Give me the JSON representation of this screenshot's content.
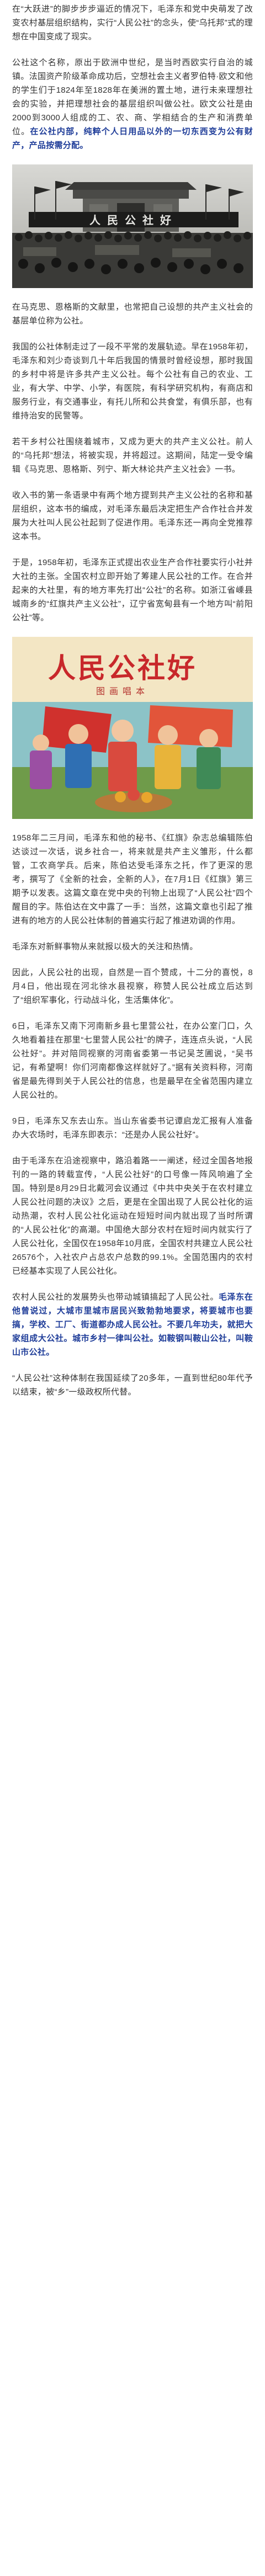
{
  "article": {
    "p1": "在“大跃进”的脚步步步逼近的情况下，毛泽东和党中央萌发了改变农村基层组织结构，实行“人民公社”的念头，使“乌托邦”式的理想在中国变成了现实。",
    "p2_pre": "公社这个名称，原出于欧洲中世纪，是当时西欧实行自治的城镇。法国资产阶级革命成功后，空想社会主义者罗伯特·欧文和他的学生们于1824年至1828年在美洲的置土地，进行未来理想社会的实验，并把理想社会的基层组织叫做公社。欧文公社是由2000到3000人组成的工、农、商、学相结合的生产和消费单位。",
    "p2_hl": "在公社内部，纯粹个人日用品以外的一切东西变为公有财产，产品按需分配。",
    "p3": "在马克思、恩格斯的文献里，也常把自己设想的共产主义社会的基层单位称为公社。",
    "p4": "我国的公社体制走过了一段不平常的发展轨迹。早在1958年初，毛泽东和刘少奇谈到几十年后我国的情景时曾经设想，那时我国的乡村中将是许多共产主义公社。每个公社有自己的农业、工业，有大学、中学、小学，有医院，有科学研究机构，有商店和服务行业，有交通事业，有托儿所和公共食堂，有俱乐部，也有维持治安的民警等。",
    "p5": "若干乡村公社围绕着城市，又成为更大的共产主义公社。前人的“乌托邦”想法，将被实现，并将超过。这期间，陆定一受令编辑《马克思、恩格斯、列宁、斯大林论共产主义社会》一书。",
    "p6": "收入书的第一条语录中有两个地方提到共产主义公社的名称和基层组织，这本书的编成，对毛泽东最后决定把生产合作社合并发展为大社叫人民公社起到了促进作用。毛泽东还一再向全党推荐这本书。",
    "p7": "于是，1958年初，毛泽东正式提出农业生产合作社要实行小社并大社的主张。全国农村立即开始了筹建人民公社的工作。在合并起来的大社里，有的地方率先打出“公社”的名称。如浙江省嵊县城南乡的“红旗共产主义公社”，辽宁省宽甸县有一个地方叫“前阳公社”等。",
    "p8_a": "1958年二三月间，毛泽东和他的秘书、《红旗》杂志总编辑陈伯达谈过一次话，说乡社合一，将来就是共产主义雏形，什么都管，工农商学兵。后来，陈伯达受毛泽东之托，作了更深的思考，撰写了《全新的社会，全新的人》，在7月1日《红旗》第三期予以发表。这篇文章在党中央的刊物上出现了“人民公社”四个醒目的字。陈伯达在文中露了一手：当然，这篇文章也引起了推进",
    "p8_b": "有的地方的人民公社体制的普遍实行起了推进劝调的作用。",
    "p9": "毛泽东对新鲜事物从来就报以极大的关注和热情。",
    "p10": "因此，人民公社的出现，自然是一百个赞成，十二分的喜悦，8月4日，他出现在河北徐水县视察，称赞人民公社成立后达到了“组织军事化，行动战斗化，生活集体化”。",
    "p11": "6日，毛泽东又南下河南新乡县七里营公社，在办公室门口，久久地看着挂在那里“七里营人民公社”的牌子，连连点头说，“人民公社好”。并对陪同视察的河南省委第一书记吴芝圃说，“吴书记，有希望啊！你们河南都像这样就好了。”据有关资料称，河南省是最先得到关于人民公社的信息，也是最早在全省范围内建立人民公社的。",
    "p12": "9日，毛泽东又东去山东。当山东省委书记谭启龙汇报有人准备办大农场时，毛泽东即表示：“还是办人民公社好”。",
    "p13": "由于毛泽东在沿途视察中，路沿着路一一阐述，经过全国各地报刊的一路的转载宣传，“人民公社好”的口号像一阵风响遍了全国。特别是8月29日北戴河会议通过《中共中央关于在农村建立人民公社问题的决议》之后，更是在全国出现了人民公社化的运动热潮，农村人民公社化运动在短短时间内就出现了当时所谓的“人民公社化”的高潮。中国绝大部分农村在短时间内就实行了人民公社化，全国仅在1958年10月底，全国农村共建立人民公社26576个，入社农户占总农户总数的99.1%。全国范围内的农村已经基本实现了人民公社化。",
    "p14_pre": "农村人民公社的发展势头也带动城镇搞起了人民公社。",
    "p14_hl": "毛泽东在他曾说过，大城市里城市居民兴致勃勃地要求，将要城市也要搞，学校、工厂、街道都办成人民公社。不要几年功夫，就把大家组成大公社。城市乡村一律叫公社。如鞍钢叫鞍山公社，叫鞍山市公社。",
    "p15": "“人民公社”这种体制在我国延续了20多年，一直到世纪80年代予以结束，被“乡”一级政权所代替。"
  },
  "images": {
    "photo_caption": "",
    "poster_title": "人民公社好",
    "poster_subtitle": "图画唱本",
    "banner_text": "人民公社好"
  }
}
